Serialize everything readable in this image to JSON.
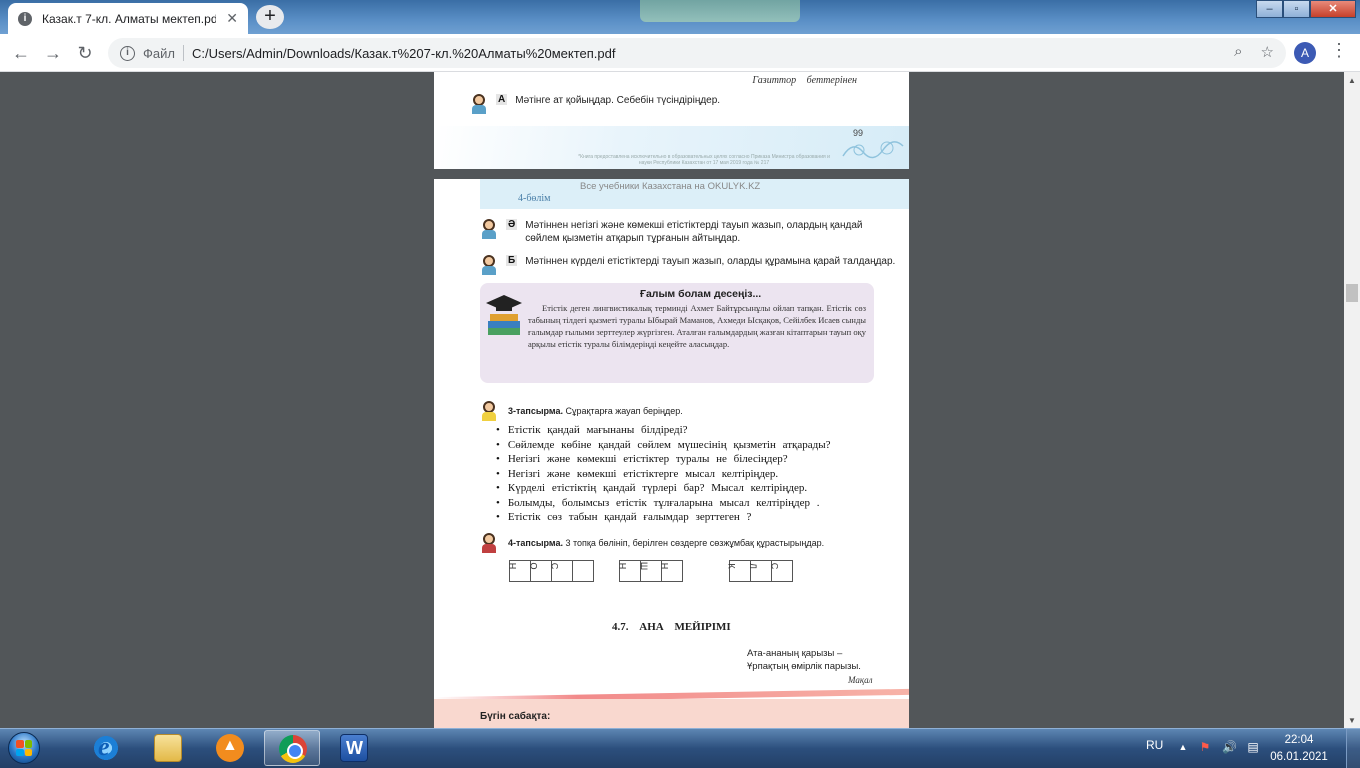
{
  "browser": {
    "tab_title": "Казак.т 7-кл. Алматы мектеп.pdf",
    "tab_close": "✕",
    "new_tab": "+",
    "favicon_letter": "i",
    "scheme": "Файл",
    "url": "C:/Users/Admin/Downloads/Казак.т%207-кл.%20Алматы%20мектеп.pdf",
    "avatar_letter": "A",
    "win_min": "–",
    "win_max": "▫",
    "win_close": "✕"
  },
  "page1": {
    "signature": "Газиттор беттерінен",
    "question_letter": "А",
    "question": "Мәтінге ат қойыңдар. Себебін түсіндіріңдер.",
    "page_number": "99",
    "footnote": "*Книга предоставлена исключительно в образовательных целях согласно Приказа Министра образования и науки Республики Казахстан от 17 мая 2019 года № 217"
  },
  "page2": {
    "watermark": "Все учебники Казахстана на OKULYK.KZ",
    "section": "4-бөлім",
    "q_a_letter": "Ә",
    "q_a_line1": "Мәтіннен негізгі және көмекші етістіктерді тауып жазып, олардың қандай",
    "q_a_line2": "сөйлем қызметін атқарып тұрғанын айтыңдар.",
    "q_b_letter": "Б",
    "q_b": "Мәтіннен күрделі етістіктерді тауып жазып, оларды құрамына қарай талдаңдар.",
    "box_title": "Ғалым болам десеңіз...",
    "box_body": "Етістік деген лингвистикалық терминді Ахмет Байтұрсынұлы ойлап тапқан. Етістік сөз табының тілдегі қызметі туралы Ыбырай Маманов, Ахмеди Ысқақов, Сейілбек Исаев сынды ғалымдар ғылыми зерттеулер жүргізген. Аталған ғалымдардың жазған кітаптарын тауып оқу арқылы етістік туралы білімдеріңді кеңейте аласыңдар.",
    "task3_label": "3-тапсырма.",
    "task3_text": "Сұрақтарға жауап беріңдер.",
    "bullets": [
      "Етістік қандай мағынаны білдіреді?",
      "Сөйлемде көбіне қандай сөйлем мүшесінің қызметін атқарады?",
      "Негізгі және көмекші етістіктер туралы не білесіңдер?",
      "Негізгі және көмекші етістіктерге мысал келтіріңдер.",
      "Күрделі етістіктің қандай түрлері бар? Мысал келтіріңдер.",
      "Болымды, болымсыз етістік тұлғаларына мысал келтіріңдер .",
      "Етістік сөз табын қандай ғалымдар зерттеген ?"
    ],
    "task4_label": "4-тапсырма.",
    "task4_text": "3 топқа бөлініп, берілген сөздерге сөзжұмбақ құрастырыңдар.",
    "grids": [
      [
        "Н",
        "О",
        "С"
      ],
      [
        "Н",
        "Ш",
        "Н"
      ],
      [
        "К",
        "Л",
        "С"
      ]
    ],
    "heading": "4.7. АНА МЕЙІРІМІ",
    "proverb_line1": "Ата-ананың қарызы –",
    "proverb_line2": "Ұрпақтың өмірлік парызы.",
    "proverb_source": "Мақал",
    "today": "Бүгін сабақта:"
  },
  "taskbar": {
    "lang": "RU",
    "time": "22:04",
    "date": "06.01.2021",
    "tray_arrow": "▲",
    "tray_flag": "⚑",
    "tray_volume": "🔊",
    "tray_network": "▤"
  },
  "colors": {
    "accent": "#3c5ab4",
    "viewer_bg": "#525659",
    "box_bg": "#ece4f0"
  }
}
